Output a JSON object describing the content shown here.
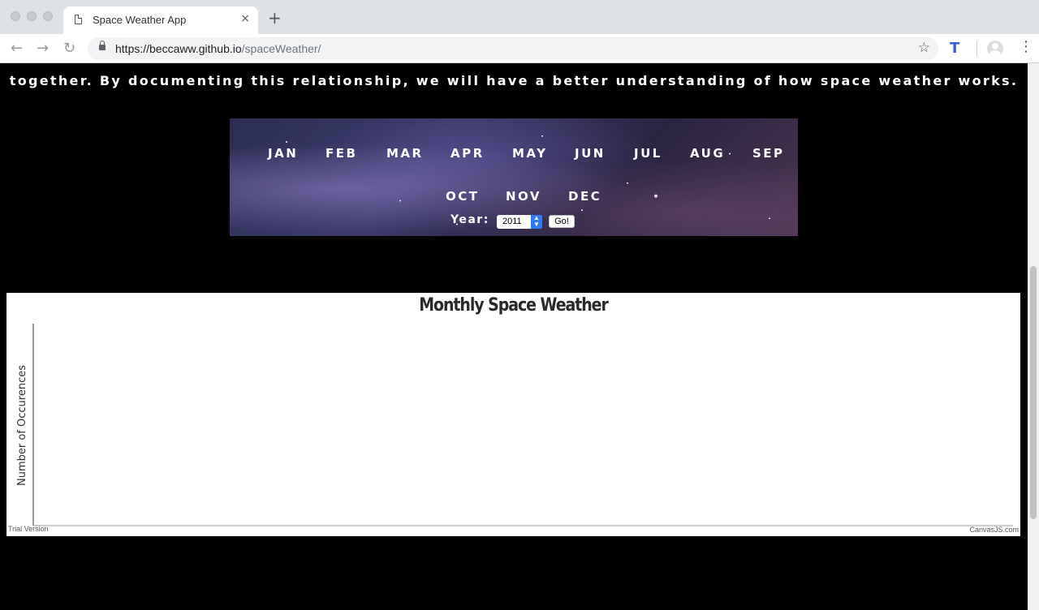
{
  "browser": {
    "tab_title": "Space Weather App",
    "tab_close": "×",
    "new_tab": "+",
    "url_host": "https://beccaww.github.io",
    "url_path": "/spaceWeather/",
    "back": "←",
    "forward": "→",
    "reload": "↻",
    "star": "☆",
    "extension": "T",
    "menu": "⋮"
  },
  "page": {
    "intro_text": "together. By documenting this relationship, we will have a better understanding of how space weather works.",
    "months": [
      "JAN",
      "FEB",
      "MAR",
      "APR",
      "MAY",
      "JUN",
      "JUL",
      "AUG",
      "SEP",
      "OCT",
      "NOV",
      "DEC"
    ],
    "year_label": "Year:",
    "year_selected": "2011",
    "go_label": "Go!"
  },
  "chart_data": {
    "type": "bar",
    "title": "Monthly Space Weather",
    "ylabel": "Number of Occurences",
    "xlabel": "",
    "categories": [],
    "values": [],
    "watermark_left": "Trial Version",
    "watermark_right": "CanvasJS.com"
  }
}
